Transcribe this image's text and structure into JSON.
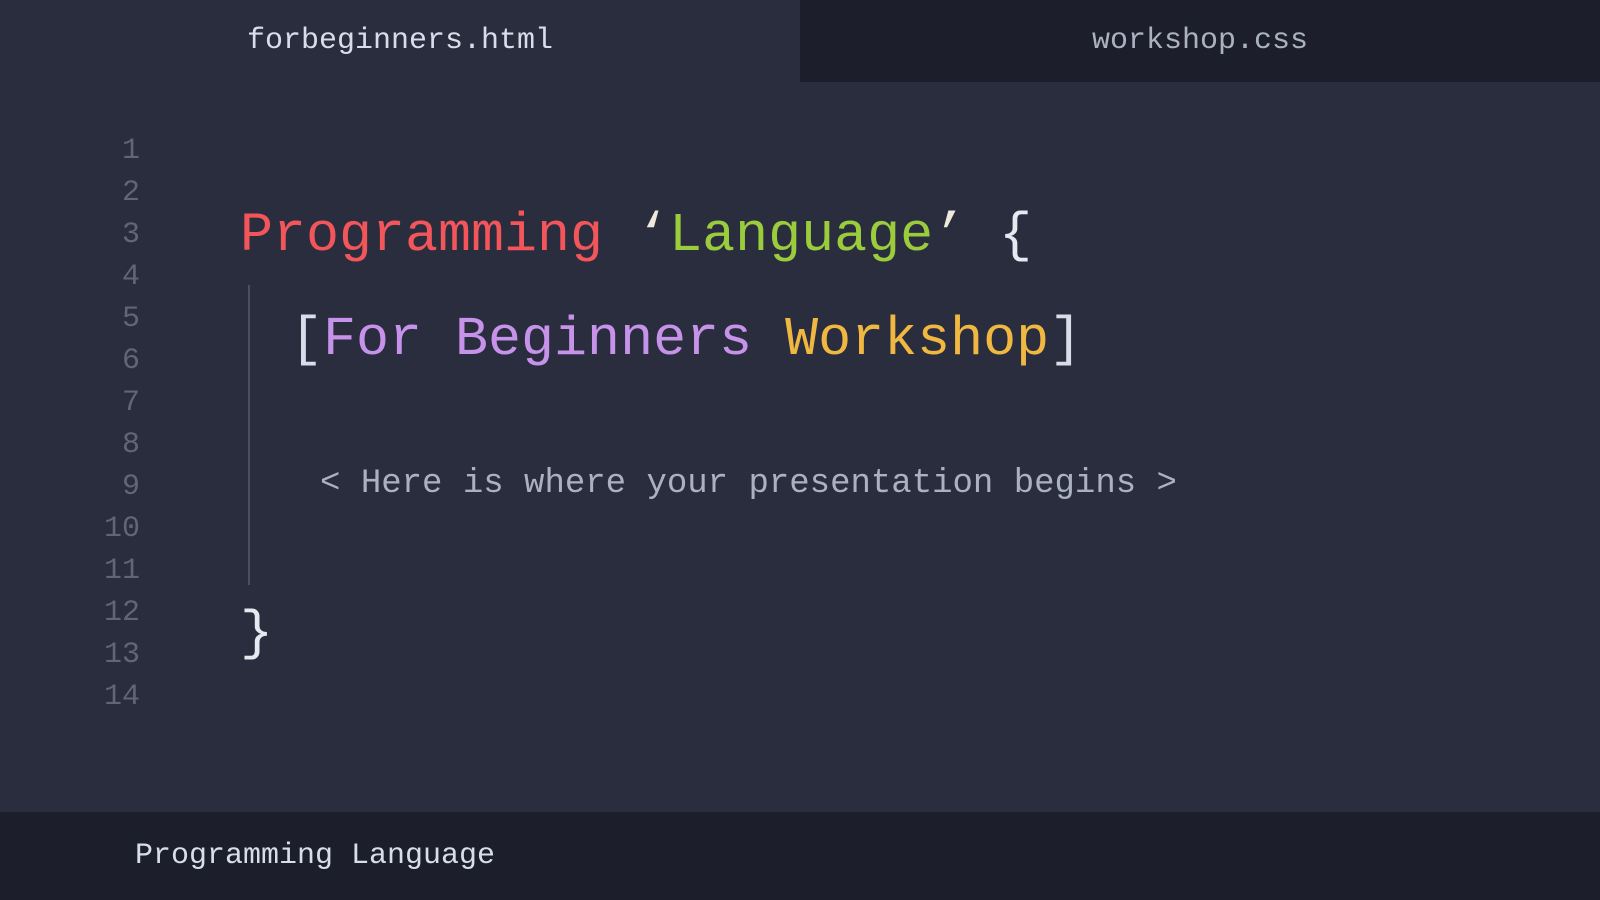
{
  "tabs": {
    "active": "forbeginners.html",
    "inactive": "workshop.css"
  },
  "gutter": {
    "lines": [
      "1",
      "2",
      "3",
      "4",
      "5",
      "6",
      "7",
      "8",
      "9",
      "10",
      "11",
      "12",
      "13",
      "14"
    ]
  },
  "content": {
    "line1": {
      "segments": [
        {
          "text": "Programming",
          "class": "c-red"
        },
        {
          "text": " ",
          "class": "c-cream"
        },
        {
          "text": "‘",
          "class": "c-cream"
        },
        {
          "text": "Language",
          "class": "c-green"
        },
        {
          "text": "’",
          "class": "c-cream"
        },
        {
          "text": " {",
          "class": "c-white"
        }
      ]
    },
    "line2": {
      "segments": [
        {
          "text": "[",
          "class": "c-bracket"
        },
        {
          "text": "For Beginners",
          "class": "c-purple"
        },
        {
          "text": " ",
          "class": "c-bracket"
        },
        {
          "text": "Workshop",
          "class": "c-yellow"
        },
        {
          "text": "]",
          "class": "c-bracket"
        }
      ]
    },
    "subtitlePrefix": "< ",
    "subtitleText": "Here is where your presentation begins",
    "subtitleSuffix": " >",
    "closingBrace": "}"
  },
  "footer": {
    "text": "Programming Language"
  },
  "colors": {
    "bg": "#292d3e",
    "tabInactiveBg": "#1c1f2b",
    "gutterText": "#5f6675",
    "red": "#f2555a",
    "green": "#9acc3c",
    "purple": "#c792ea",
    "yellow": "#f0b840",
    "cream": "#efe9dc",
    "white": "#e6e9f0",
    "muted": "#aab2c0"
  }
}
